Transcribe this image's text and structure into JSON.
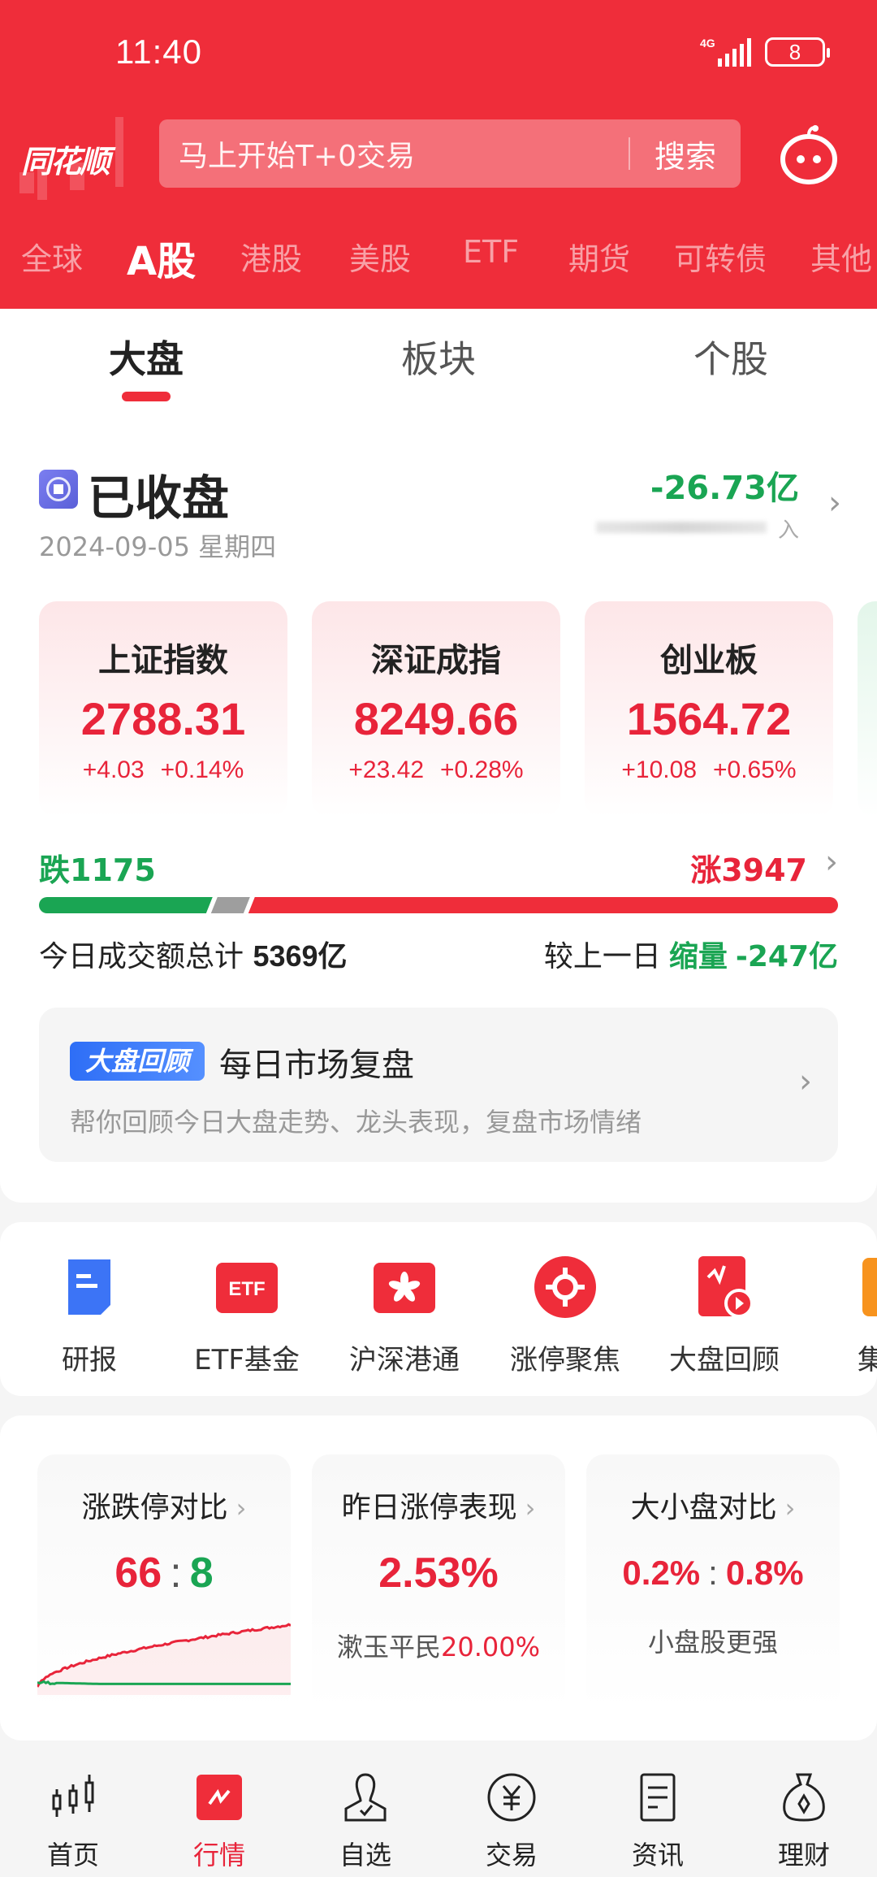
{
  "status_bar": {
    "time": "11:40",
    "network": "4G",
    "battery": "8"
  },
  "header": {
    "logo": "同花顺",
    "search_placeholder": "马上开始T+0交易",
    "search_button": "搜索",
    "robot_icon": "robot-assistant-icon"
  },
  "market_tabs": [
    {
      "label": "全球",
      "active": false
    },
    {
      "label": "A股",
      "active": true
    },
    {
      "label": "港股",
      "active": false
    },
    {
      "label": "美股",
      "active": false
    },
    {
      "label": "ETF",
      "active": false
    },
    {
      "label": "期货",
      "active": false
    },
    {
      "label": "可转债",
      "active": false
    },
    {
      "label": "其他",
      "active": false
    }
  ],
  "sub_tabs": [
    {
      "label": "大盘",
      "active": true
    },
    {
      "label": "板块",
      "active": false
    },
    {
      "label": "个股",
      "active": false
    }
  ],
  "market_status": {
    "title": "已收盘",
    "date": "2024-09-05 星期四",
    "flow_value": "-26.73亿",
    "flow_label_visible": "入"
  },
  "indices": [
    {
      "name": "上证指数",
      "value": "2788.31",
      "change": "+4.03",
      "pct": "+0.14%"
    },
    {
      "name": "深证成指",
      "value": "8249.66",
      "change": "+23.42",
      "pct": "+0.28%"
    },
    {
      "name": "创业板",
      "value": "1564.72",
      "change": "+10.08",
      "pct": "+0.65%"
    },
    {
      "name": "",
      "value": "",
      "change": "",
      "pct": ""
    }
  ],
  "breadth": {
    "fall_label": "跌1175",
    "rise_label": "涨3947",
    "fall_count": 1175,
    "rise_count": 3947,
    "colors": {
      "fall": "#1aa553",
      "flat": "#9e9e9e",
      "rise": "#ef2d3a"
    }
  },
  "turnover": {
    "label": "今日成交额总计",
    "value": "5369亿",
    "compare_label": "较上一日",
    "compare_trend": "缩量",
    "compare_value": "-247亿"
  },
  "review": {
    "badge": "大盘回顾",
    "title": "每日市场复盘",
    "desc": "帮你回顾今日大盘走势、龙头表现，复盘市场情绪"
  },
  "shortcuts": [
    {
      "label": "研报",
      "icon": "research-report-icon"
    },
    {
      "label": "ETF基金",
      "icon": "etf-fund-icon",
      "glyph": "ETF"
    },
    {
      "label": "沪深港通",
      "icon": "hk-connect-icon"
    },
    {
      "label": "涨停聚焦",
      "icon": "limit-up-focus-icon"
    },
    {
      "label": "大盘回顾",
      "icon": "market-review-icon"
    },
    {
      "label": "集合",
      "icon": "collection-icon"
    }
  ],
  "stats": [
    {
      "title": "涨跌停对比",
      "up": "66",
      "down": "8"
    },
    {
      "title": "昨日涨停表现",
      "value": "2.53%",
      "stock": "漱玉平民",
      "stock_pct": "20.00%"
    },
    {
      "title": "大小盘对比",
      "large": "0.2%",
      "small": "0.8%",
      "note": "小盘股更强"
    }
  ],
  "bottom_nav": [
    {
      "label": "首页",
      "icon": "candlestick-icon",
      "active": false
    },
    {
      "label": "行情",
      "icon": "market-chart-icon",
      "active": true
    },
    {
      "label": "自选",
      "icon": "watchlist-person-icon",
      "active": false
    },
    {
      "label": "交易",
      "icon": "yuan-coin-icon",
      "active": false
    },
    {
      "label": "资讯",
      "icon": "news-doc-icon",
      "active": false
    },
    {
      "label": "理财",
      "icon": "money-bag-icon",
      "active": false
    }
  ]
}
